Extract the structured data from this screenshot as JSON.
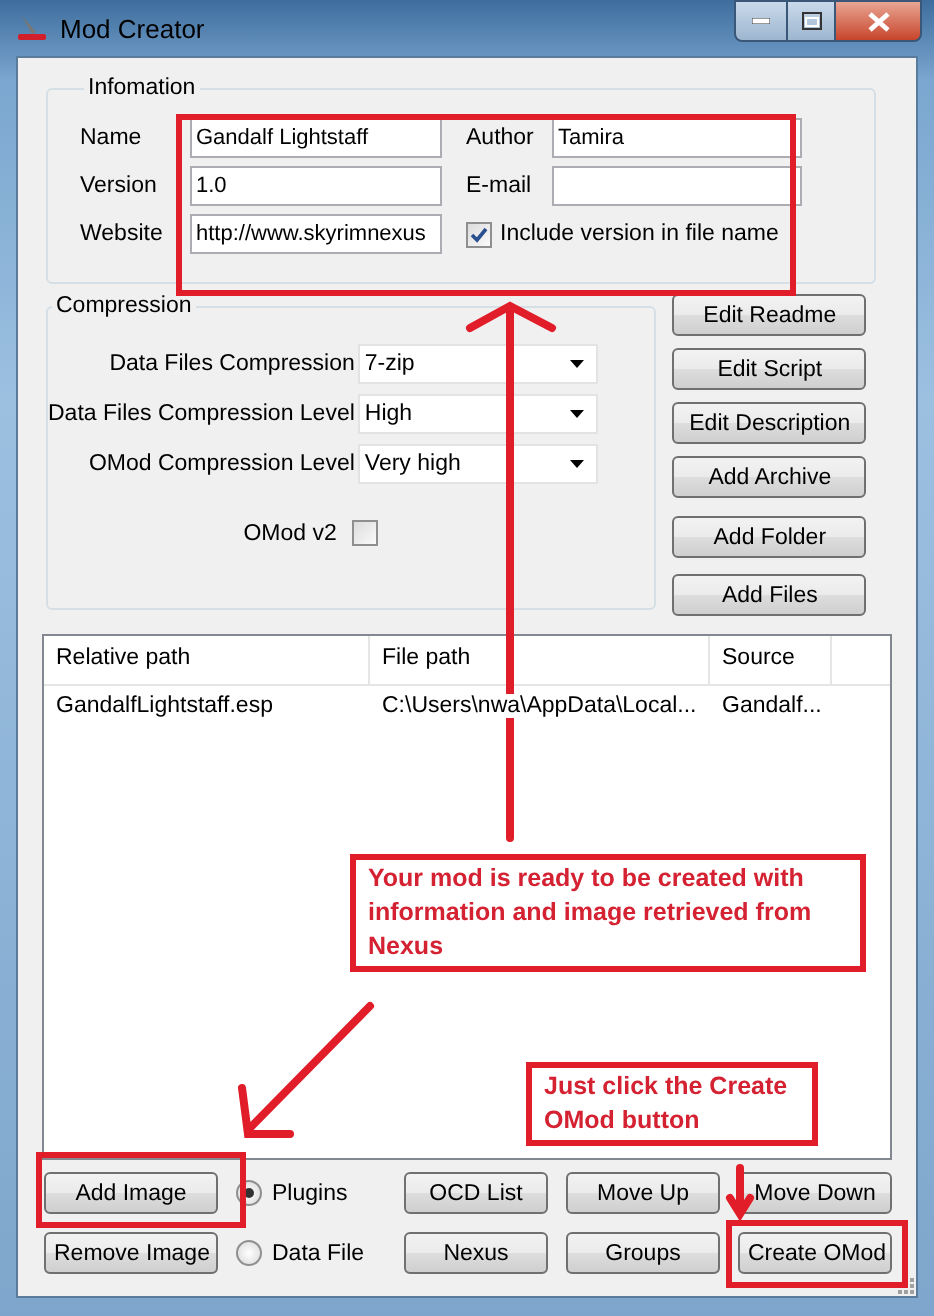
{
  "window": {
    "title": "Mod Creator"
  },
  "information": {
    "legend": "Infomation",
    "left_fields": [
      {
        "label": "Name",
        "value": "Gandalf Lightstaff"
      },
      {
        "label": "Version",
        "value": "1.0"
      },
      {
        "label": "Website",
        "value": "http://www.skyrimnexus"
      }
    ],
    "right_fields": [
      {
        "label": "Author",
        "value": "Tamira"
      },
      {
        "label": "E-mail"
      }
    ],
    "include_version": {
      "label": "Include version in file name",
      "checked": true
    }
  },
  "compression": {
    "legend": "Compression",
    "dropdowns": [
      {
        "label": "Data Files Compression",
        "value": "7-zip"
      },
      {
        "label": "Data Files Compression Level",
        "value": "High"
      },
      {
        "label": "OMod Compression Level",
        "value": "Very high"
      }
    ],
    "omod_v2": {
      "label": "OMod v2",
      "checked": false
    }
  },
  "side_buttons": [
    "Edit Readme",
    "Edit Script",
    "Edit Description",
    "Add Archive",
    "Add Folder",
    "Add Files"
  ],
  "file_list": {
    "columns": [
      "Relative path",
      "File path",
      "Source"
    ],
    "rows": [
      [
        "GandalfLightstaff.esp",
        "C:\\Users\\nwa\\AppData\\Local...",
        "Gandalf..."
      ]
    ]
  },
  "bottom": {
    "image_buttons": [
      "Add Image",
      "Remove Image"
    ],
    "radios": [
      {
        "label": "Plugins",
        "selected": true
      },
      {
        "label": "Data File",
        "selected": false
      }
    ],
    "buttons": [
      "OCD List",
      "Move Up",
      "Move Down",
      "Nexus",
      "Groups",
      "Create OMod"
    ]
  },
  "callouts": [
    "Your mod is ready to be created with information and image retrieved from Nexus",
    "Just click the Create OMod button"
  ]
}
